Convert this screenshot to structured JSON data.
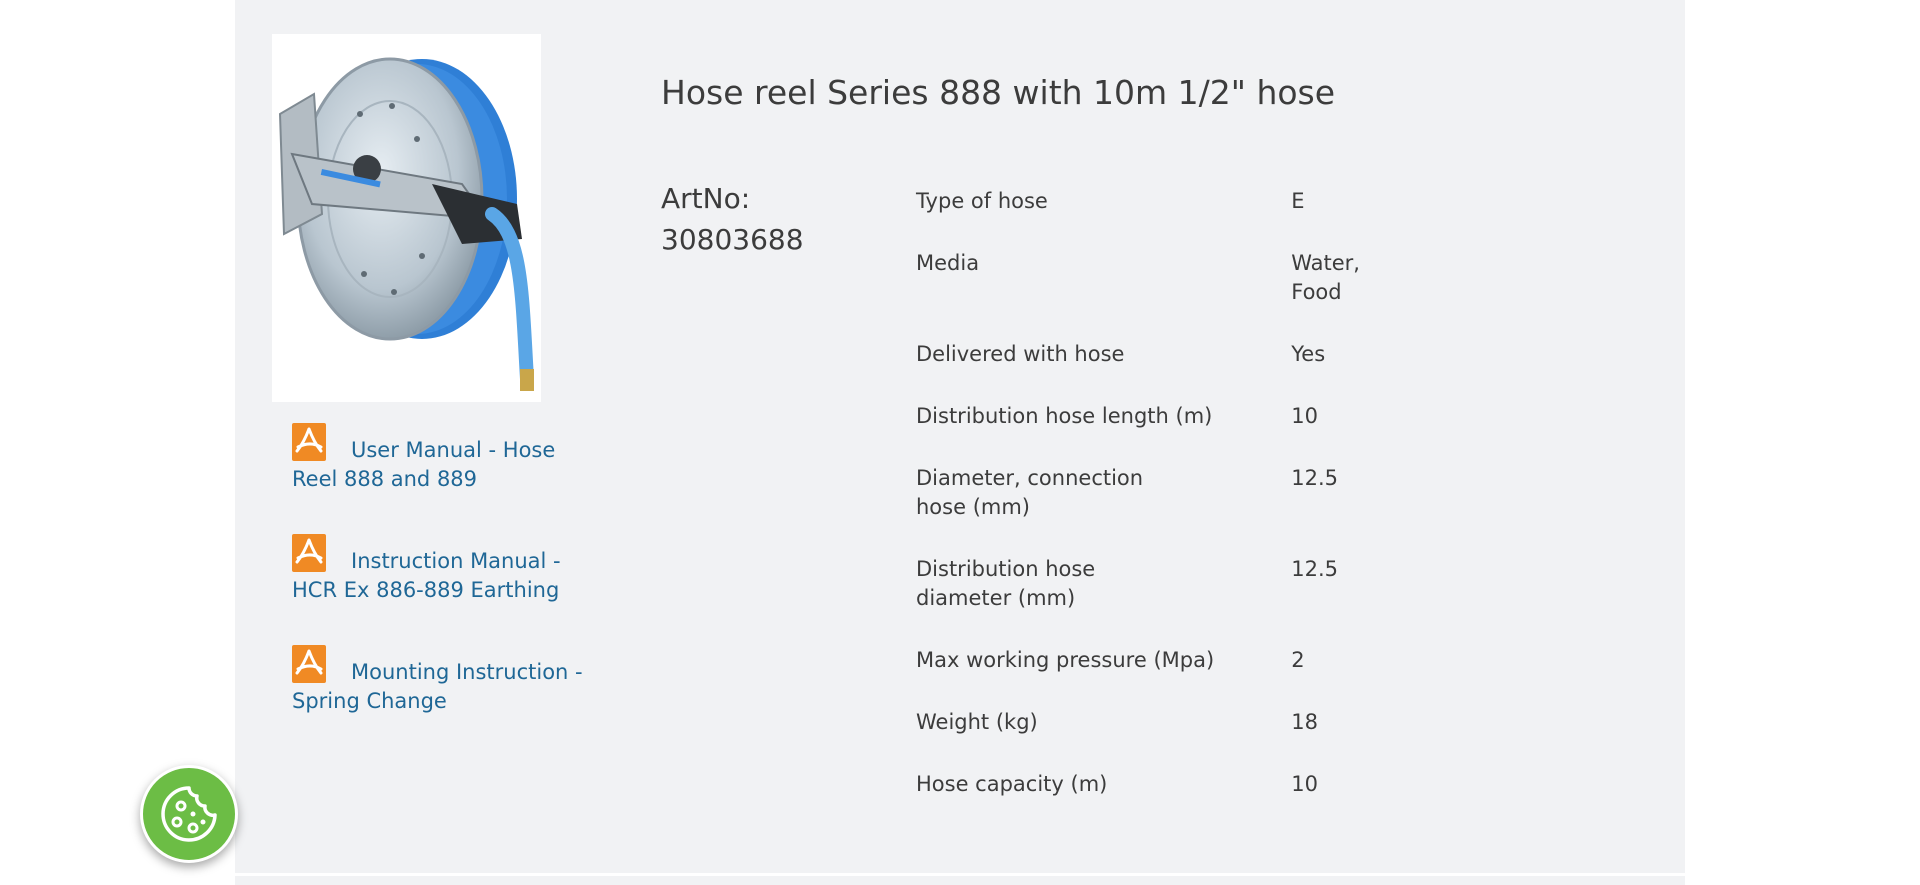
{
  "product": {
    "title": "Hose reel Series 888 with 10m 1/2\" hose",
    "artno_label": "ArtNo:",
    "artno_value": "30803688"
  },
  "documents": [
    {
      "label": "User Manual - Hose Reel 888 and 889",
      "icon": "pdf-icon"
    },
    {
      "label": "Instruction Manual - HCR Ex 886-889 Earthing",
      "icon": "pdf-icon"
    },
    {
      "label": "Mounting Instruction - Spring Change",
      "icon": "pdf-icon"
    }
  ],
  "specs": [
    {
      "label": "Type of hose",
      "value": "E"
    },
    {
      "label": "Media",
      "value": "Water, Food"
    },
    {
      "label": "Delivered with hose",
      "value": "Yes"
    },
    {
      "label": "Distribution hose length (m)",
      "value": "10"
    },
    {
      "label": "Diameter, connection hose (mm)",
      "value": "12.5"
    },
    {
      "label": "Distribution hose diameter (mm)",
      "value": "12.5"
    },
    {
      "label": "Max working pressure (Mpa)",
      "value": "2"
    },
    {
      "label": "Weight (kg)",
      "value": "18"
    },
    {
      "label": "Hose capacity (m)",
      "value": "10"
    }
  ],
  "cookie_button": {
    "icon": "cookie-icon"
  },
  "colors": {
    "panel_bg": "#f1f2f4",
    "link": "#1f6796",
    "text": "#3c3c3c",
    "pdf_orange": "#f08a24",
    "cookie_green": "#6cbd45"
  }
}
